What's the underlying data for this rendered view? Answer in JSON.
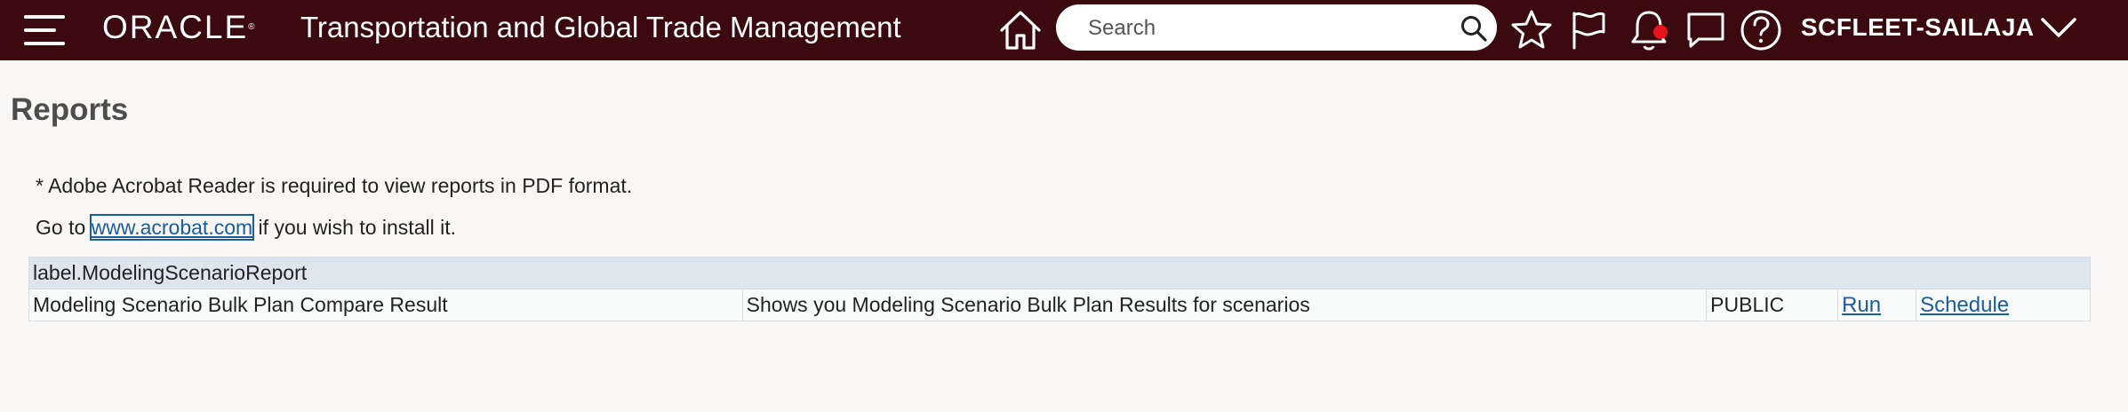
{
  "header": {
    "logo_text": "ORACLE",
    "logo_reg": "®",
    "app_title": "Transportation and Global Trade Management",
    "search_placeholder": "Search",
    "username": "SCFLEET-SAILAJA",
    "icons": [
      "hamburger-menu-icon",
      "home-icon",
      "search-icon",
      "star-icon",
      "flag-icon",
      "bell-icon",
      "chat-icon",
      "help-icon",
      "chevron-down-icon"
    ],
    "notification_dot_color": "#e8141c",
    "bar_color": "#3a0a0e"
  },
  "page": {
    "title": "Reports",
    "acrobat_note": "* Adobe Acrobat Reader is required to view reports in PDF format.",
    "goto_prefix": "Go to ",
    "goto_link": "www.acrobat.com",
    "goto_suffix": " if you wish to install it."
  },
  "reports": {
    "group_label": "label.ModelingScenarioReport",
    "rows": [
      {
        "name": "Modeling Scenario Bulk Plan Compare Result",
        "description": "Shows you Modeling Scenario Bulk Plan Results for scenarios",
        "visibility": "PUBLIC",
        "run_label": "Run",
        "schedule_label": "Schedule"
      }
    ]
  }
}
